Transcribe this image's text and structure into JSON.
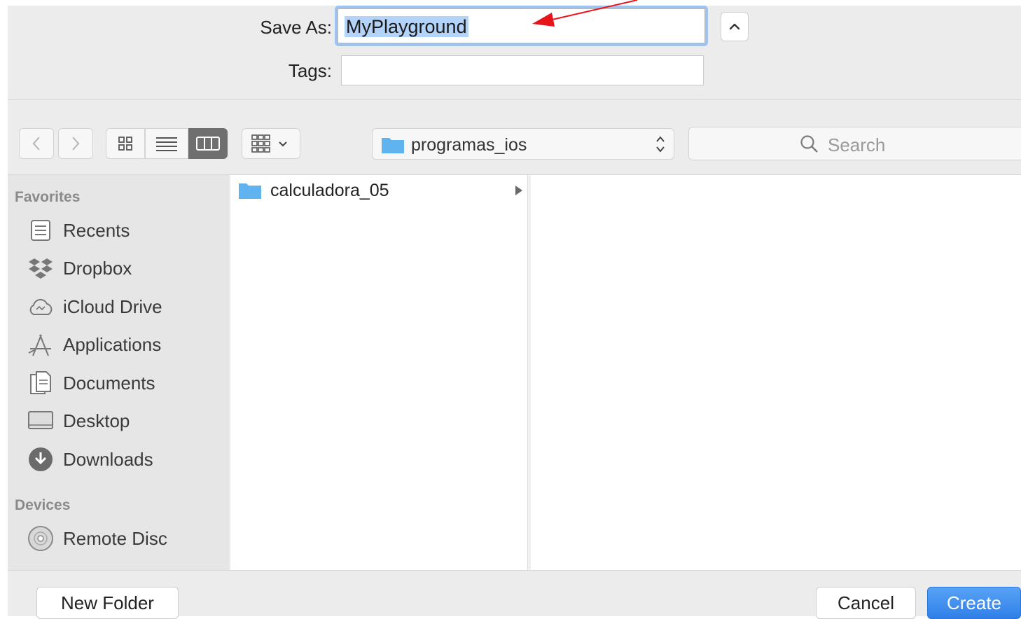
{
  "save_form": {
    "save_as_label": "Save As:",
    "save_as_value": "MyPlayground",
    "tags_label": "Tags:",
    "tags_value": ""
  },
  "toolbar": {
    "back": "back",
    "forward": "forward",
    "view_modes": [
      "icon-view",
      "list-view",
      "column-view"
    ],
    "active_view": "column-view",
    "arrange": "arrange",
    "current_folder": "programas_ios",
    "search_placeholder": "Search"
  },
  "sidebar": {
    "favorites_header": "Favorites",
    "favorites": [
      {
        "label": "Recents",
        "icon": "recents-icon"
      },
      {
        "label": "Dropbox",
        "icon": "dropbox-icon"
      },
      {
        "label": "iCloud Drive",
        "icon": "icloud-icon"
      },
      {
        "label": "Applications",
        "icon": "applications-icon"
      },
      {
        "label": "Documents",
        "icon": "documents-icon"
      },
      {
        "label": "Desktop",
        "icon": "desktop-icon"
      },
      {
        "label": "Downloads",
        "icon": "downloads-icon"
      }
    ],
    "devices_header": "Devices",
    "devices": [
      {
        "label": "Remote Disc",
        "icon": "remote-disc-icon"
      }
    ]
  },
  "browser": {
    "column1": [
      {
        "label": "calculadora_05",
        "icon": "folder-icon",
        "has_children": true
      }
    ]
  },
  "footer": {
    "new_folder": "New Folder",
    "cancel": "Cancel",
    "create": "Create"
  },
  "colors": {
    "accent": "#2f7fe8",
    "selection": "#b3d3f8",
    "annotation_arrow": "#e8141b",
    "folder": "#5fb4f0"
  }
}
